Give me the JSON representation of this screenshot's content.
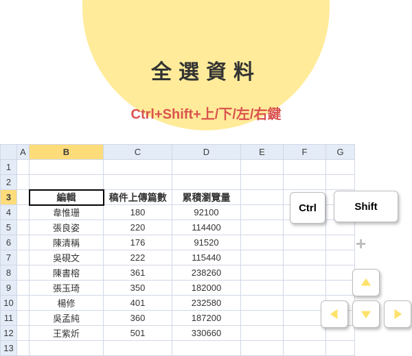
{
  "title": "全選資料",
  "subtitle": "Ctrl+Shift+上/下/左/右鍵",
  "columns": [
    "A",
    "B",
    "C",
    "D",
    "E",
    "F",
    "G"
  ],
  "selected_col": "B",
  "selected_row": 3,
  "rows_shown": [
    1,
    2,
    3,
    4,
    5,
    6,
    7,
    8,
    9,
    10,
    11,
    12,
    13
  ],
  "table": {
    "header_row": 3,
    "headers": {
      "B": "編輯",
      "C": "稿件上傳篇數",
      "D": "累積瀏覽量"
    },
    "data": [
      {
        "row": 4,
        "B": "韋惟珊",
        "C": 180,
        "D": 92100
      },
      {
        "row": 5,
        "B": "張良姿",
        "C": 220,
        "D": 114400
      },
      {
        "row": 6,
        "B": "陳清稱",
        "C": 176,
        "D": 91520
      },
      {
        "row": 7,
        "B": "吳硯文",
        "C": 222,
        "D": 115440
      },
      {
        "row": 8,
        "B": "陳書榕",
        "C": 361,
        "D": 238260
      },
      {
        "row": 9,
        "B": "張玉琦",
        "C": 350,
        "D": 182000
      },
      {
        "row": 10,
        "B": "楊修",
        "C": 401,
        "D": 232580
      },
      {
        "row": 11,
        "B": "吳孟純",
        "C": 360,
        "D": 187200
      },
      {
        "row": 12,
        "B": "王紫炘",
        "C": 501,
        "D": 330660
      }
    ]
  },
  "keys": {
    "ctrl": "Ctrl",
    "shift": "Shift"
  },
  "icons": {
    "arrow_up": "arrow-up-icon",
    "arrow_down": "arrow-down-icon",
    "arrow_left": "arrow-left-icon",
    "arrow_right": "arrow-right-icon"
  }
}
